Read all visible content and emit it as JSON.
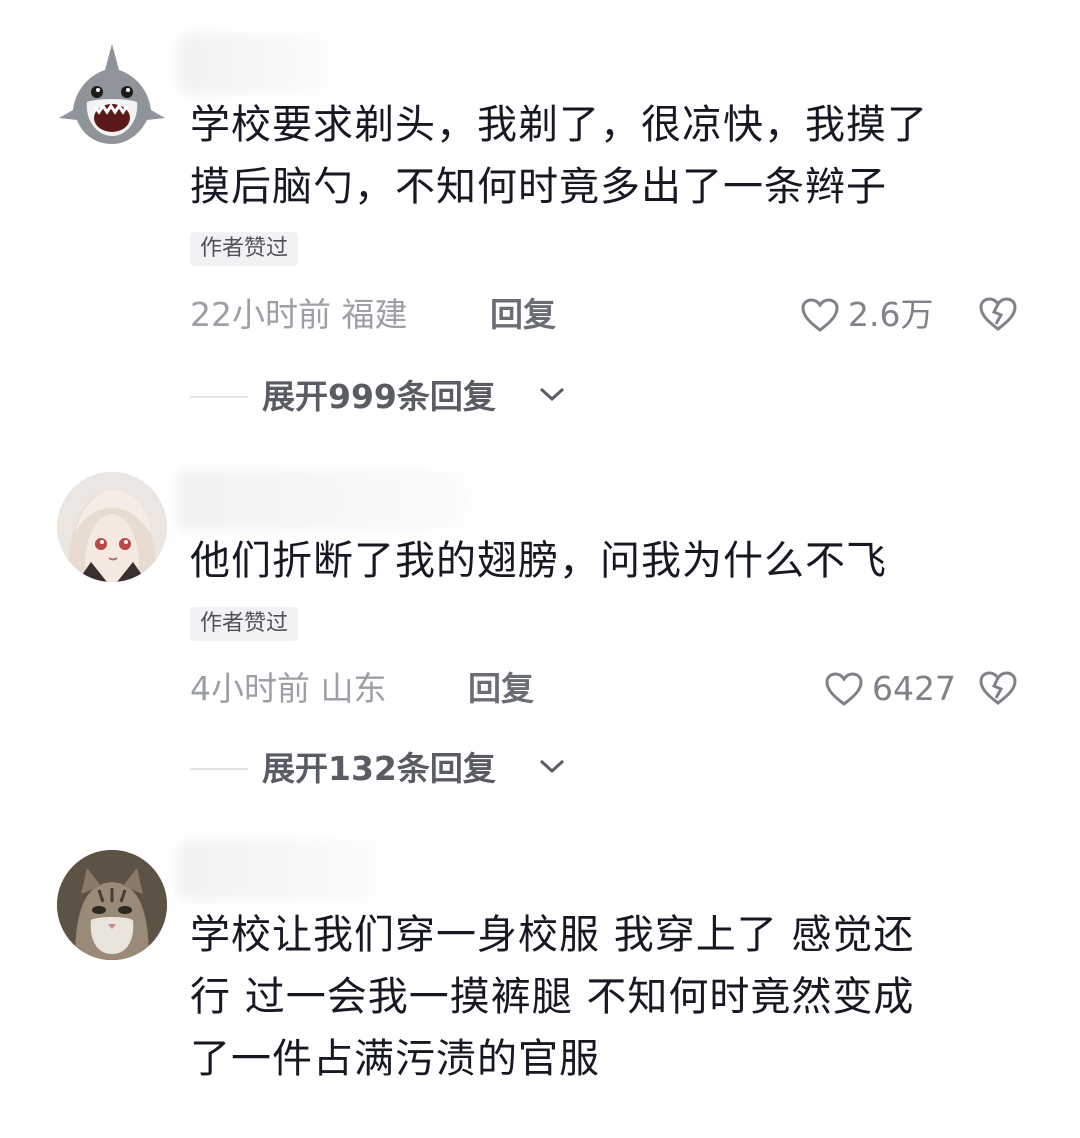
{
  "comments": [
    {
      "text_lines": [
        "学校要求剃头，我剃了，很凉快，我摸了",
        "摸后脑勺，不知何时竟多出了一条辫子"
      ],
      "author_liked": "作者赞过",
      "time": "22小时前",
      "location": "福建",
      "reply_label": "回复",
      "likes": "2.6万",
      "expand_label": "展开999条回复"
    },
    {
      "text_lines": [
        "他们折断了我的翅膀，问我为什么不飞"
      ],
      "author_liked": "作者赞过",
      "time": "4小时前",
      "location": "山东",
      "reply_label": "回复",
      "likes": "6427",
      "expand_label": "展开132条回复"
    },
    {
      "text_lines": [
        "学校让我们穿一身校服 我穿上了 感觉还",
        "行 过一会我一摸裤腿 不知何时竟然变成",
        "了一件占满污渍的官服"
      ]
    }
  ],
  "icons": {
    "like": "heart-outline-icon",
    "dislike": "broken-heart-icon",
    "expand": "chevron-down-icon"
  },
  "colors": {
    "text": "#161823",
    "meta": "#9d9fa6",
    "badge_bg": "#f2f2f4"
  }
}
